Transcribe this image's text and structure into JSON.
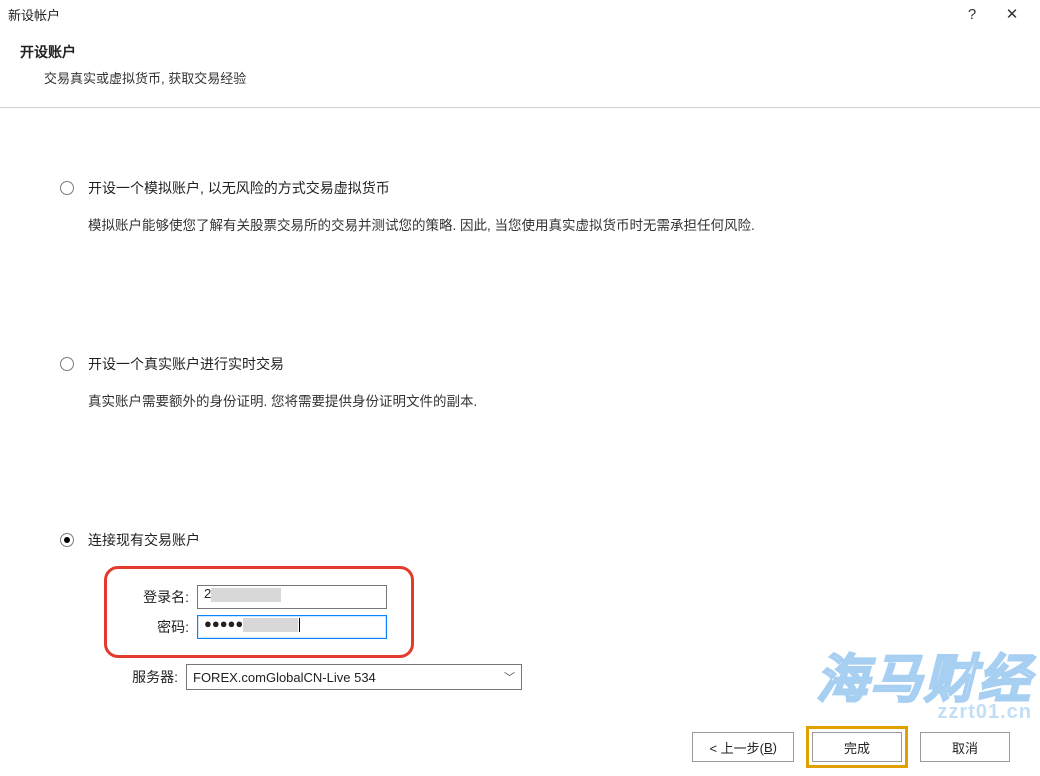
{
  "window": {
    "title": "新设帐户",
    "help": "?",
    "close": "✕"
  },
  "header": {
    "title": "开设账户",
    "sub": "交易真实或虚拟货币, 获取交易经验"
  },
  "options": {
    "demo": {
      "title": "开设一个模拟账户, 以无风险的方式交易虚拟货币",
      "desc": "模拟账户能够使您了解有关股票交易所的交易并测试您的策略. 因此, 当您使用真实虚拟货币时无需承担任何风险."
    },
    "real": {
      "title": "开设一个真实账户进行实时交易",
      "desc": "真实账户需要额外的身份证明. 您将需要提供身份证明文件的副本."
    },
    "existing": {
      "title": "连接现有交易账户",
      "login_label": "登录名:",
      "login_value_visible": "2",
      "password_label": "密码:",
      "password_dots": "●●●●●",
      "server_label": "服务器:",
      "server_value": "FOREX.comGlobalCN-Live 534"
    }
  },
  "footer": {
    "back_pre": "< 上一步(",
    "back_u": "B",
    "back_post": ")",
    "finish": "完成",
    "cancel": "取消"
  },
  "watermark": {
    "big": "海马财经",
    "small": "zzrt01.cn"
  }
}
